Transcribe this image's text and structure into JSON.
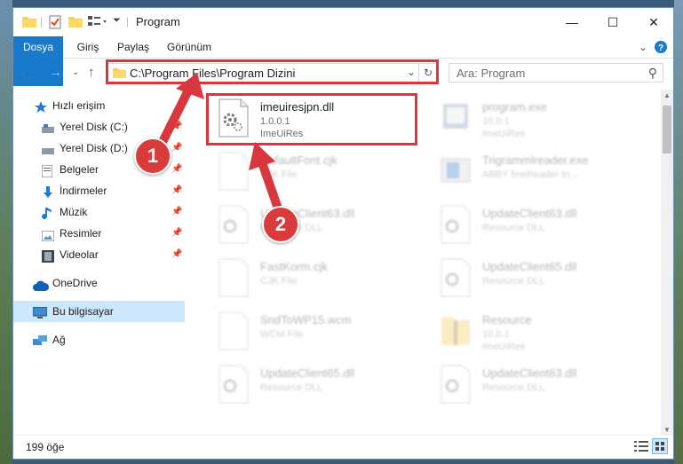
{
  "window": {
    "title": "Program"
  },
  "window_controls": {
    "minimize": "—",
    "maximize": "☐",
    "close": "✕"
  },
  "ribbon": {
    "tabs": [
      "Dosya",
      "Giriş",
      "Paylaş",
      "Görünüm"
    ]
  },
  "address": {
    "path": "C:\\Program Files\\Program Dizini"
  },
  "search": {
    "placeholder": "Ara: Program"
  },
  "sidebar": {
    "items": [
      {
        "label": "Hızlı erişim",
        "icon": "star-icon"
      },
      {
        "label": "Yerel Disk (C:)",
        "icon": "drive-icon",
        "pinned": true
      },
      {
        "label": "Yerel Disk (D:)",
        "icon": "drive-icon",
        "pinned": true
      },
      {
        "label": "Belgeler",
        "icon": "documents-icon",
        "pinned": true
      },
      {
        "label": "İndirmeler",
        "icon": "downloads-icon",
        "pinned": true
      },
      {
        "label": "Müzik",
        "icon": "music-icon",
        "pinned": true
      },
      {
        "label": "Resimler",
        "icon": "pictures-icon",
        "pinned": true
      },
      {
        "label": "Videolar",
        "icon": "videos-icon",
        "pinned": true
      },
      {
        "label": "OneDrive",
        "icon": "cloud-icon"
      },
      {
        "label": "Bu bilgisayar",
        "icon": "computer-icon",
        "selected": true
      },
      {
        "label": "Ağ",
        "icon": "network-icon"
      }
    ]
  },
  "files": [
    {
      "name": "imeuiresjpn.dll",
      "line2": "1.0.0.1",
      "line3": "ImeUiRes",
      "icon": "dll-gear-icon"
    },
    {
      "name": "program.exe",
      "line2": "10.0.1",
      "line3": "ImeUiRes",
      "icon": "exe-icon"
    },
    {
      "name": "DefaultFont.cjk",
      "line2": "CJK File",
      "line3": "",
      "icon": "blank-file-icon"
    },
    {
      "name": "Trigrammlreader.exe",
      "line2": "ABBY fineReader tri...",
      "line3": "",
      "icon": "exe-icon"
    },
    {
      "name": "UpdateClient63.dll",
      "line2": "Resource DLL",
      "line3": "",
      "icon": "dll-gear-icon"
    },
    {
      "name": "UpdateClient63.dll",
      "line2": "Resource DLL",
      "line3": "",
      "icon": "dll-gear-icon"
    },
    {
      "name": "FastKorm.cjk",
      "line2": "CJK File",
      "line3": "",
      "icon": "blank-file-icon"
    },
    {
      "name": "UpdateClient65.dll",
      "line2": "Resource DLL",
      "line3": "",
      "icon": "dll-gear-icon"
    },
    {
      "name": "SndToWP15.wcm",
      "line2": "WCM File",
      "line3": "",
      "icon": "blank-file-icon"
    },
    {
      "name": "Resource",
      "line2": "10.0.1",
      "line3": "ImeUiRes",
      "icon": "folder-zip-icon"
    },
    {
      "name": "UpdateClient65.dll",
      "line2": "Resource DLL",
      "line3": "",
      "icon": "dll-gear-icon"
    },
    {
      "name": "UpdateClient63.dll",
      "line2": "Resource DLL",
      "line3": "",
      "icon": "dll-gear-icon"
    }
  ],
  "status": {
    "item_count": "199 öğe"
  },
  "annotations": {
    "step1": "1",
    "step2": "2",
    "color": "#d9363e"
  }
}
